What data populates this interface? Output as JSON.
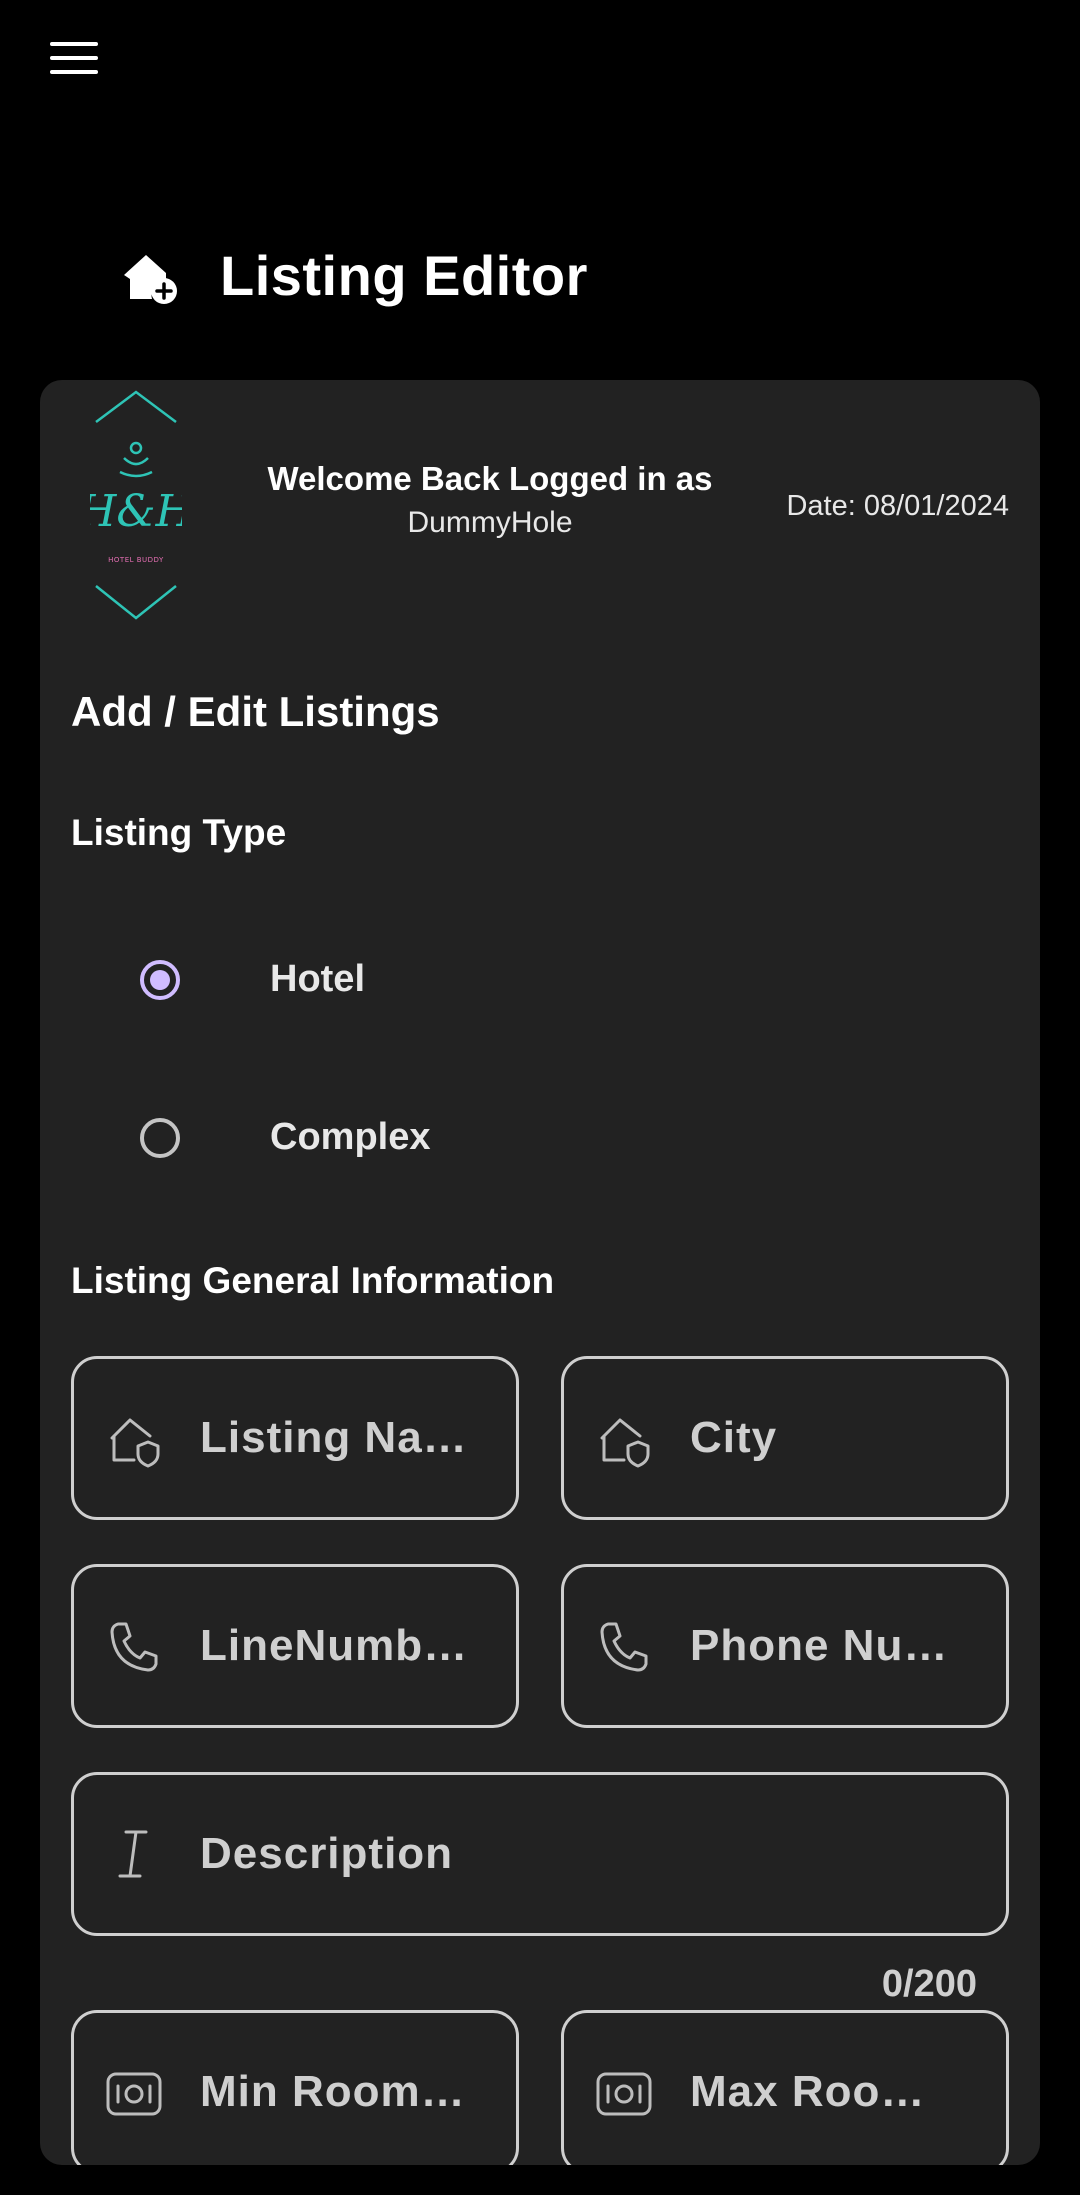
{
  "app": {
    "page_title": "Listing Editor"
  },
  "header": {
    "welcome_line": "Welcome Back Logged in as",
    "username": "DummyHole",
    "date": "Date: 08/01/2024",
    "logo_text": "H&H",
    "logo_tagline": "HOTEL BUDDY"
  },
  "form": {
    "section_title": "Add / Edit Listings",
    "listing_type_title": "Listing Type",
    "listing_type_options": [
      {
        "label": "Hotel",
        "selected": true
      },
      {
        "label": "Complex",
        "selected": false
      }
    ],
    "general_info_title": "Listing General Information",
    "fields": {
      "listing_name": "Listing Na…",
      "city": "City",
      "line_number": "LineNumb…",
      "phone_number": "Phone Nu…",
      "description": "Description",
      "description_counter": "0/200",
      "min_rooms": "Min Room…",
      "max_rooms": "Max Roo…"
    }
  },
  "colors": {
    "background": "#000000",
    "card": "#222222",
    "accent": "#d0bcff",
    "outline": "#cfcfcf",
    "logo_teal": "#2ec4b6"
  }
}
